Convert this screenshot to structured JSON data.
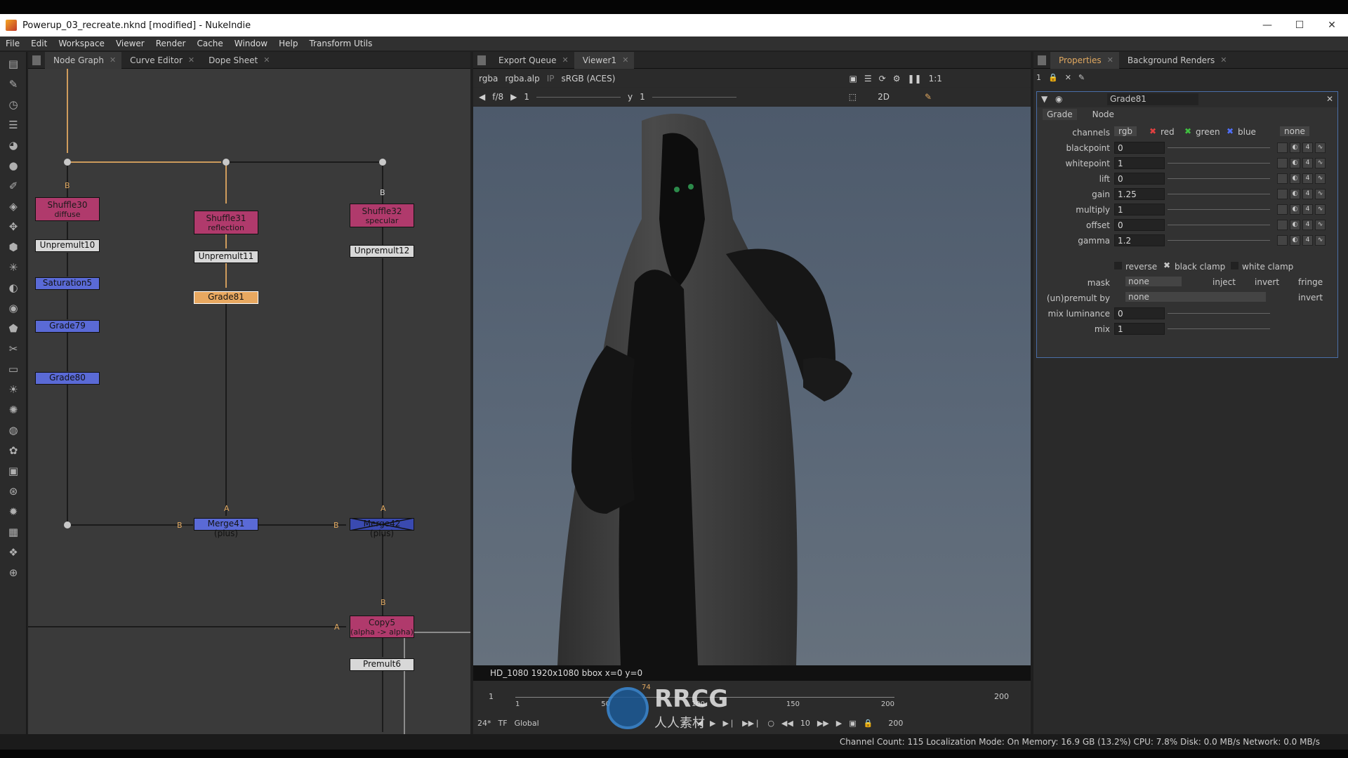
{
  "window": {
    "title": "Powerup_03_recreate.nknd [modified] - NukeIndie",
    "controls": [
      "—",
      "☐",
      "✕"
    ]
  },
  "menubar": [
    "File",
    "Edit",
    "Workspace",
    "Viewer",
    "Render",
    "Cache",
    "Window",
    "Help",
    "Transform Utils"
  ],
  "left_tabs": [
    {
      "label": "Node Graph",
      "active": true
    },
    {
      "label": "Curve Editor",
      "active": false
    },
    {
      "label": "Dope Sheet",
      "active": false
    }
  ],
  "nodes": {
    "shuffle30": {
      "label": "Shuffle30",
      "sub": "diffuse"
    },
    "shuffle31": {
      "label": "Shuffle31",
      "sub": "reflection"
    },
    "shuffle32": {
      "label": "Shuffle32",
      "sub": "specular"
    },
    "unpremult10": "Unpremult10",
    "unpremult11": "Unpremult11",
    "unpremult12": "Unpremult12",
    "saturation5": "Saturation5",
    "grade81": "Grade81",
    "grade79": "Grade79",
    "grade80": "Grade80",
    "merge41": "Merge41 (plus)",
    "merge42": "Merge42 (plus)",
    "copy5": {
      "label": "Copy5",
      "sub": "(alpha -> alpha)"
    },
    "premult6": "Premult6"
  },
  "input_labels": {
    "b": "B",
    "a": "A"
  },
  "viewer_tabs": [
    {
      "label": "Export Queue",
      "active": false
    },
    {
      "label": "Viewer1",
      "active": true
    }
  ],
  "viewer": {
    "channels": "rgba",
    "alpha": "rgba.alp",
    "ip": "IP",
    "colorspace": "sRGB (ACES)",
    "zoom": "1:1",
    "fstop": "f/8",
    "frame_field": "1",
    "y_label": "y",
    "y_field": "1",
    "view_mode": "2D",
    "info": "HD_1080 1920x1080  bbox  x=0 y=0"
  },
  "timeline": {
    "start": "1",
    "end": "200",
    "current": "74",
    "ticks": [
      "1",
      "50",
      "100",
      "150",
      "200"
    ],
    "fps": "24*",
    "tf": "TF",
    "global": "Global",
    "step": "10",
    "range_end": "200"
  },
  "right_tabs": [
    {
      "label": "Properties",
      "active": true
    },
    {
      "label": "Background Renders",
      "active": false
    }
  ],
  "properties": {
    "count": "1",
    "node_name": "Grade81",
    "tabs": [
      "Grade",
      "Node"
    ],
    "channels_label": "channels",
    "channels_value": "rgb",
    "ch_red": "red",
    "ch_green": "green",
    "ch_blue": "blue",
    "ch_none": "none",
    "params": [
      {
        "label": "blackpoint",
        "value": "0"
      },
      {
        "label": "whitepoint",
        "value": "1"
      },
      {
        "label": "lift",
        "value": "0"
      },
      {
        "label": "gain",
        "value": "1.25"
      },
      {
        "label": "multiply",
        "value": "1"
      },
      {
        "label": "offset",
        "value": "0"
      },
      {
        "label": "gamma",
        "value": "1.2"
      }
    ],
    "reverse": "reverse",
    "black_clamp": "black clamp",
    "white_clamp": "white clamp",
    "mask_label": "mask",
    "mask_value": "none",
    "inject": "inject",
    "invert": "invert",
    "fringe": "fringe",
    "unpremult_label": "(un)premult by",
    "unpremult_value": "none",
    "invert2": "invert",
    "mix_lum_label": "mix luminance",
    "mix_lum_value": "0",
    "mix_label": "mix",
    "mix_value": "1"
  },
  "status": "Channel Count: 115  Localization Mode: On  Memory: 16.9 GB (13.2%)  CPU: 7.8%  Disk: 0.0 MB/s  Network: 0.0 MB/s",
  "watermark": "RRCG",
  "watermark_sub": "人人素材",
  "colors": {
    "accent": "#e0a860",
    "pink_node": "#b03a6c",
    "blue_node": "#5a6ad6",
    "selection": "#4a6ea8"
  }
}
